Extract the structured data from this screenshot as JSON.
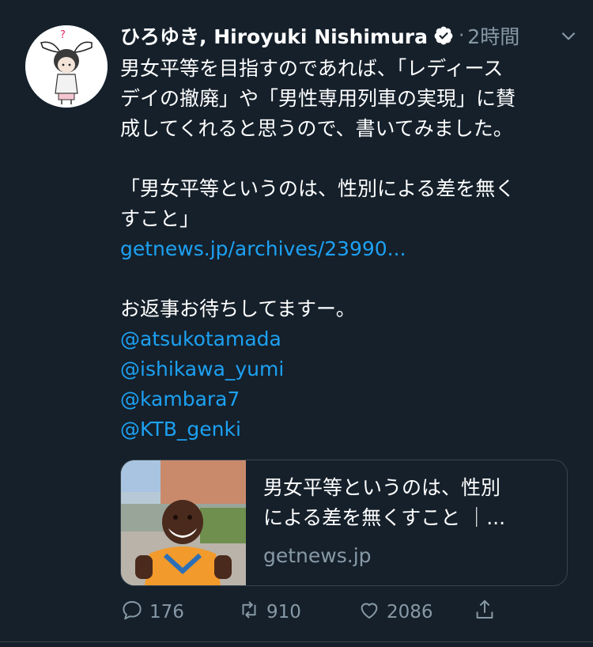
{
  "tweet": {
    "author_name": "ひろゆき, Hiroyuki Nishimura",
    "separator": "·",
    "time": "2時間",
    "lines": [
      "男女平等を目指すのであれば、「レディース",
      "デイの撤廃」や「男性専用列車の実現」に賛",
      "成してくれると思うので、書いてみました。",
      "「男女平等というのは、性別による差を無く",
      "すこと」",
      "お返事お待ちしてますー。"
    ],
    "link_url": "getnews.jp/archives/23990...",
    "mentions": [
      "@atsukotamada",
      "@ishikawa_yumi",
      "@kambara7",
      "@KTB_genki"
    ]
  },
  "card": {
    "title_line1": "男女平等というのは、性別",
    "title_line2": "による差を無くすこと ｜...",
    "domain": "getnews.jp"
  },
  "actions": {
    "reply_count": "176",
    "retweet_count": "910",
    "like_count": "2086"
  },
  "icons": {
    "verified": "verified-badge-icon",
    "caret": "chevron-down-icon",
    "reply": "reply-icon",
    "retweet": "retweet-icon",
    "like": "heart-icon",
    "share": "share-icon"
  },
  "colors": {
    "background": "#15202b",
    "link": "#1da1f2",
    "secondary_text": "#8899a6",
    "border": "#38444d"
  }
}
